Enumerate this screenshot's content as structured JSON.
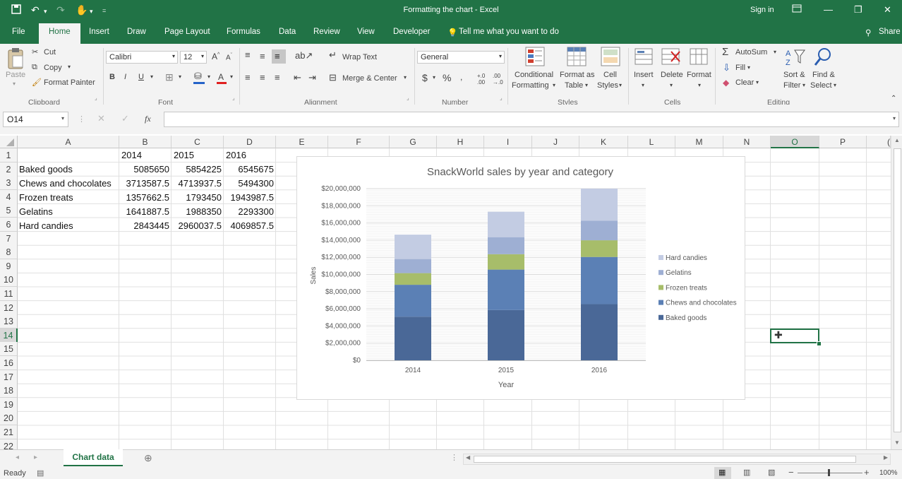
{
  "app": {
    "title": "Formatting the chart - Excel",
    "sign_in": "Sign in",
    "share": "Share"
  },
  "tabs": [
    "File",
    "Home",
    "Insert",
    "Draw",
    "Page Layout",
    "Formulas",
    "Data",
    "Review",
    "View",
    "Developer"
  ],
  "tell_me": "Tell me what you want to do",
  "ribbon": {
    "clipboard": {
      "cut": "Cut",
      "copy": "Copy",
      "format_painter": "Format Painter",
      "paste": "Paste",
      "group": "Clipboard"
    },
    "font": {
      "name": "Calibri",
      "size": "12",
      "group": "Font"
    },
    "alignment": {
      "wrap": "Wrap Text",
      "merge": "Merge & Center",
      "group": "Alignment"
    },
    "number": {
      "format": "General",
      "group": "Number"
    },
    "styles": {
      "cond1": "Conditional",
      "cond2": "Formatting",
      "fmt1": "Format as",
      "fmt2": "Table",
      "cell1": "Cell",
      "cell2": "Styles",
      "group": "Styles"
    },
    "cells": {
      "insert": "Insert",
      "delete": "Delete",
      "format": "Format",
      "group": "Cells"
    },
    "editing": {
      "autosum": "AutoSum",
      "fill": "Fill",
      "clear": "Clear",
      "sort1": "Sort &",
      "sort2": "Filter",
      "find1": "Find &",
      "find2": "Select",
      "group": "Editing"
    }
  },
  "formula_bar": {
    "name_box": "O14",
    "fx": "fx",
    "value": ""
  },
  "columns": [
    "A",
    "B",
    "C",
    "D",
    "E",
    "F",
    "G",
    "H",
    "I",
    "J",
    "K",
    "L",
    "M",
    "N",
    "O",
    "P"
  ],
  "rows": [
    "1",
    "2",
    "3",
    "4",
    "5",
    "6",
    "7",
    "8",
    "9",
    "10",
    "11",
    "12",
    "13",
    "14",
    "15",
    "16",
    "17",
    "18",
    "19",
    "20",
    "21",
    "22"
  ],
  "table": {
    "header": [
      "",
      "2014",
      "2015",
      "2016"
    ],
    "data": [
      [
        "Baked goods",
        "5085650",
        "5854225",
        "6545675"
      ],
      [
        "Chews and chocolates",
        "3713587.5",
        "4713937.5",
        "5494300"
      ],
      [
        "Frozen treats",
        "1357662.5",
        "1793450",
        "1943987.5"
      ],
      [
        "Gelatins",
        "1641887.5",
        "1988350",
        "2293300"
      ],
      [
        "Hard candies",
        "2843445",
        "2960037.5",
        "4069857.5"
      ]
    ]
  },
  "chart_data": {
    "type": "bar",
    "stacked": true,
    "title": "SnackWorld sales by year and category",
    "xlabel": "Year",
    "ylabel": "Sales",
    "categories": [
      "2014",
      "2015",
      "2016"
    ],
    "ylim": [
      0,
      20000000
    ],
    "ytick_labels": [
      "$0",
      "$2,000,000",
      "$4,000,000",
      "$6,000,000",
      "$8,000,000",
      "$10,000,000",
      "$12,000,000",
      "$14,000,000",
      "$16,000,000",
      "$18,000,000",
      "$20,000,000"
    ],
    "legend_position": "right",
    "series": [
      {
        "name": "Baked goods",
        "values": [
          5085650,
          5854225,
          6545675
        ],
        "color": "#4a6897"
      },
      {
        "name": "Chews and chocolates",
        "values": [
          3713587.5,
          4713937.5,
          5494300
        ],
        "color": "#5b80b5"
      },
      {
        "name": "Frozen treats",
        "values": [
          1357662.5,
          1793450,
          1943987.5
        ],
        "color": "#a7bd6a"
      },
      {
        "name": "Gelatins",
        "values": [
          1641887.5,
          1988350,
          2293300
        ],
        "color": "#9eafd3"
      },
      {
        "name": "Hard candies",
        "values": [
          2843445,
          2960037.5,
          4069857.5
        ],
        "color": "#c3cce3"
      }
    ]
  },
  "sheet_tabs": [
    "Chart data"
  ],
  "status": {
    "ready": "Ready",
    "zoom": "100%"
  },
  "colors": {
    "excel_green": "#217346",
    "selection": "#217346"
  }
}
